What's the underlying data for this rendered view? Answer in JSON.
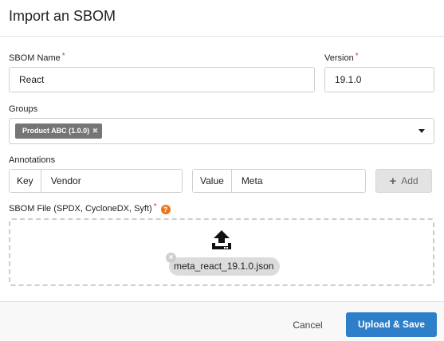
{
  "dialog": {
    "title": "Import an SBOM"
  },
  "form": {
    "sbom_name": {
      "label": "SBOM Name",
      "required": "*",
      "value": "React"
    },
    "version": {
      "label": "Version",
      "required": "*",
      "value": "19.1.0"
    },
    "groups": {
      "label": "Groups",
      "selected_chip": "Product ABC (1.0.0)",
      "chip_remove": "✖"
    },
    "annotations": {
      "label": "Annotations",
      "key_label": "Key",
      "key_value": "Vendor",
      "value_label": "Value",
      "value_value": "Meta",
      "add_label": "Add",
      "add_icon": "+"
    },
    "sbom_file": {
      "label": "SBOM File (SPDX, CycloneDX, Syft)",
      "required": "*",
      "help_icon": "?",
      "file_name": "meta_react_19.1.0.json",
      "remove_icon": "×"
    }
  },
  "footer": {
    "cancel_label": "Cancel",
    "submit_label": "Upload & Save"
  },
  "colors": {
    "primary": "#2e7fc9",
    "required": "#d9342b",
    "help": "#e8741c",
    "chip": "#757575"
  },
  "icons": [
    "upload-icon",
    "help-icon",
    "chevron-down-icon",
    "close-icon",
    "plus-icon"
  ]
}
